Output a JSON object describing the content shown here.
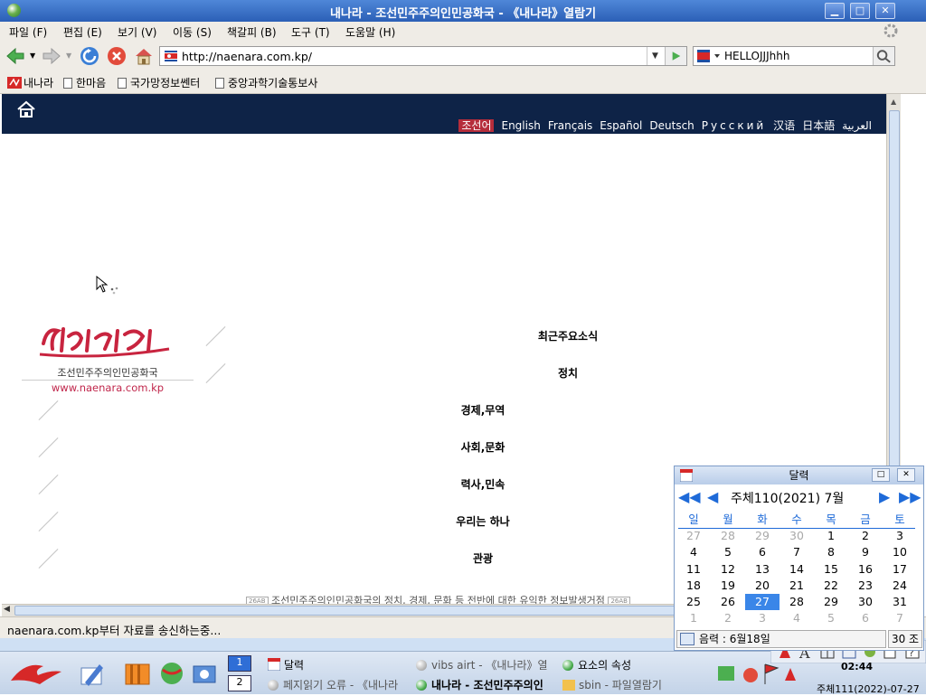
{
  "window": {
    "title": "내나라 - 조선민주주의인민공화국 - 《내나라》열람기"
  },
  "menu": [
    "파일 (F)",
    "편집 (E)",
    "보기 (V)",
    "이동 (S)",
    "책갈피 (B)",
    "도구 (T)",
    "도움말 (H)"
  ],
  "toolbar": {
    "url": "http://naenara.com.kp/",
    "search_value": "HELLOJJJhhh"
  },
  "bookmarks": [
    "내나라",
    "한마음",
    "국가망정보쎈터",
    "중앙과학기술통보사"
  ],
  "site": {
    "languages": [
      "조선어",
      "English",
      "Français",
      "Español",
      "Deutsch",
      "Русский",
      "汉语",
      "日本語",
      "العربية"
    ],
    "logo_subtitle": "조선민주주의인민공화국",
    "logo_url": "www.naenara.com.kp",
    "nav": [
      "최근주요소식",
      "정치",
      "경제,무역",
      "사회,문화",
      "력사,민속",
      "우리는 하나",
      "관광"
    ],
    "footer": {
      "tag": "26AB",
      "text": "조선민주주의인민공화국의 정치, 경제, 문화 등 전반에 대한 유익한 정보발생거점"
    }
  },
  "status": {
    "message": "naenara.com.kp부터 자료를 송신하는중..."
  },
  "calendar": {
    "title": "달력",
    "month_label": "주체110(2021)  7월",
    "weekdays": [
      "일",
      "월",
      "화",
      "수",
      "목",
      "금",
      "토"
    ],
    "weeks": [
      [
        "27",
        "28",
        "29",
        "30",
        "1",
        "2",
        "3"
      ],
      [
        "4",
        "5",
        "6",
        "7",
        "8",
        "9",
        "10"
      ],
      [
        "11",
        "12",
        "13",
        "14",
        "15",
        "16",
        "17"
      ],
      [
        "18",
        "19",
        "20",
        "21",
        "22",
        "23",
        "24"
      ],
      [
        "25",
        "26",
        "27",
        "28",
        "29",
        "30",
        "31"
      ],
      [
        "1",
        "2",
        "3",
        "4",
        "5",
        "6",
        "7"
      ]
    ],
    "today": "27",
    "lunar": "음력 : 6월18일",
    "temp": "30 조"
  },
  "taskbar": {
    "workspaces": [
      "1",
      "2"
    ],
    "tasks": [
      "달력",
      "vibs airt - 《내나라》열",
      "요소의 속성",
      "페지읽기 오류 - 《내나라",
      "내나라 - 조선민주주의인",
      "sbin - 파일열람기"
    ],
    "clock": "02:44",
    "date": "주체111(2022)-07-27"
  }
}
